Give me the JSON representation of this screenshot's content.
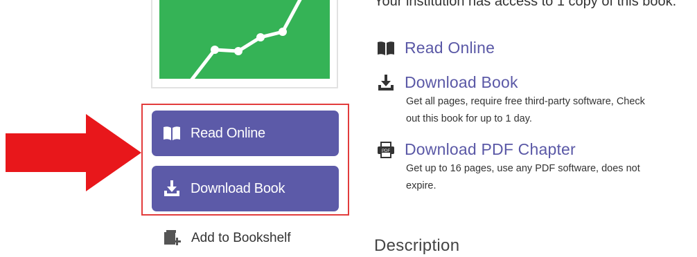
{
  "access_notice": "Your institution has access to 1 copy of this book.",
  "buttons": {
    "read_online": "Read Online",
    "download_book": "Download Book"
  },
  "bookshelf_label": "Add to Bookshelf",
  "options": {
    "read_online": {
      "label": "Read Online"
    },
    "download_book": {
      "label": "Download Book",
      "desc_line1": "Get all pages, require free third-party software, Check",
      "desc_line2": "out this book for up to 1 day."
    },
    "download_pdf": {
      "label": "Download PDF Chapter",
      "desc_line1": "Get up to 16 pages, use any PDF software, does not",
      "desc_line2": "expire."
    }
  },
  "description_heading": "Description",
  "colors": {
    "button_bg": "#5c5aa8",
    "link": "#5a58a6",
    "highlight": "#e23b3b",
    "arrow": "#e8171b",
    "cover_green": "#35b356"
  },
  "icons": [
    "book-icon",
    "download-icon",
    "pdf-icon",
    "bookshelf-add-icon",
    "red-arrow"
  ]
}
